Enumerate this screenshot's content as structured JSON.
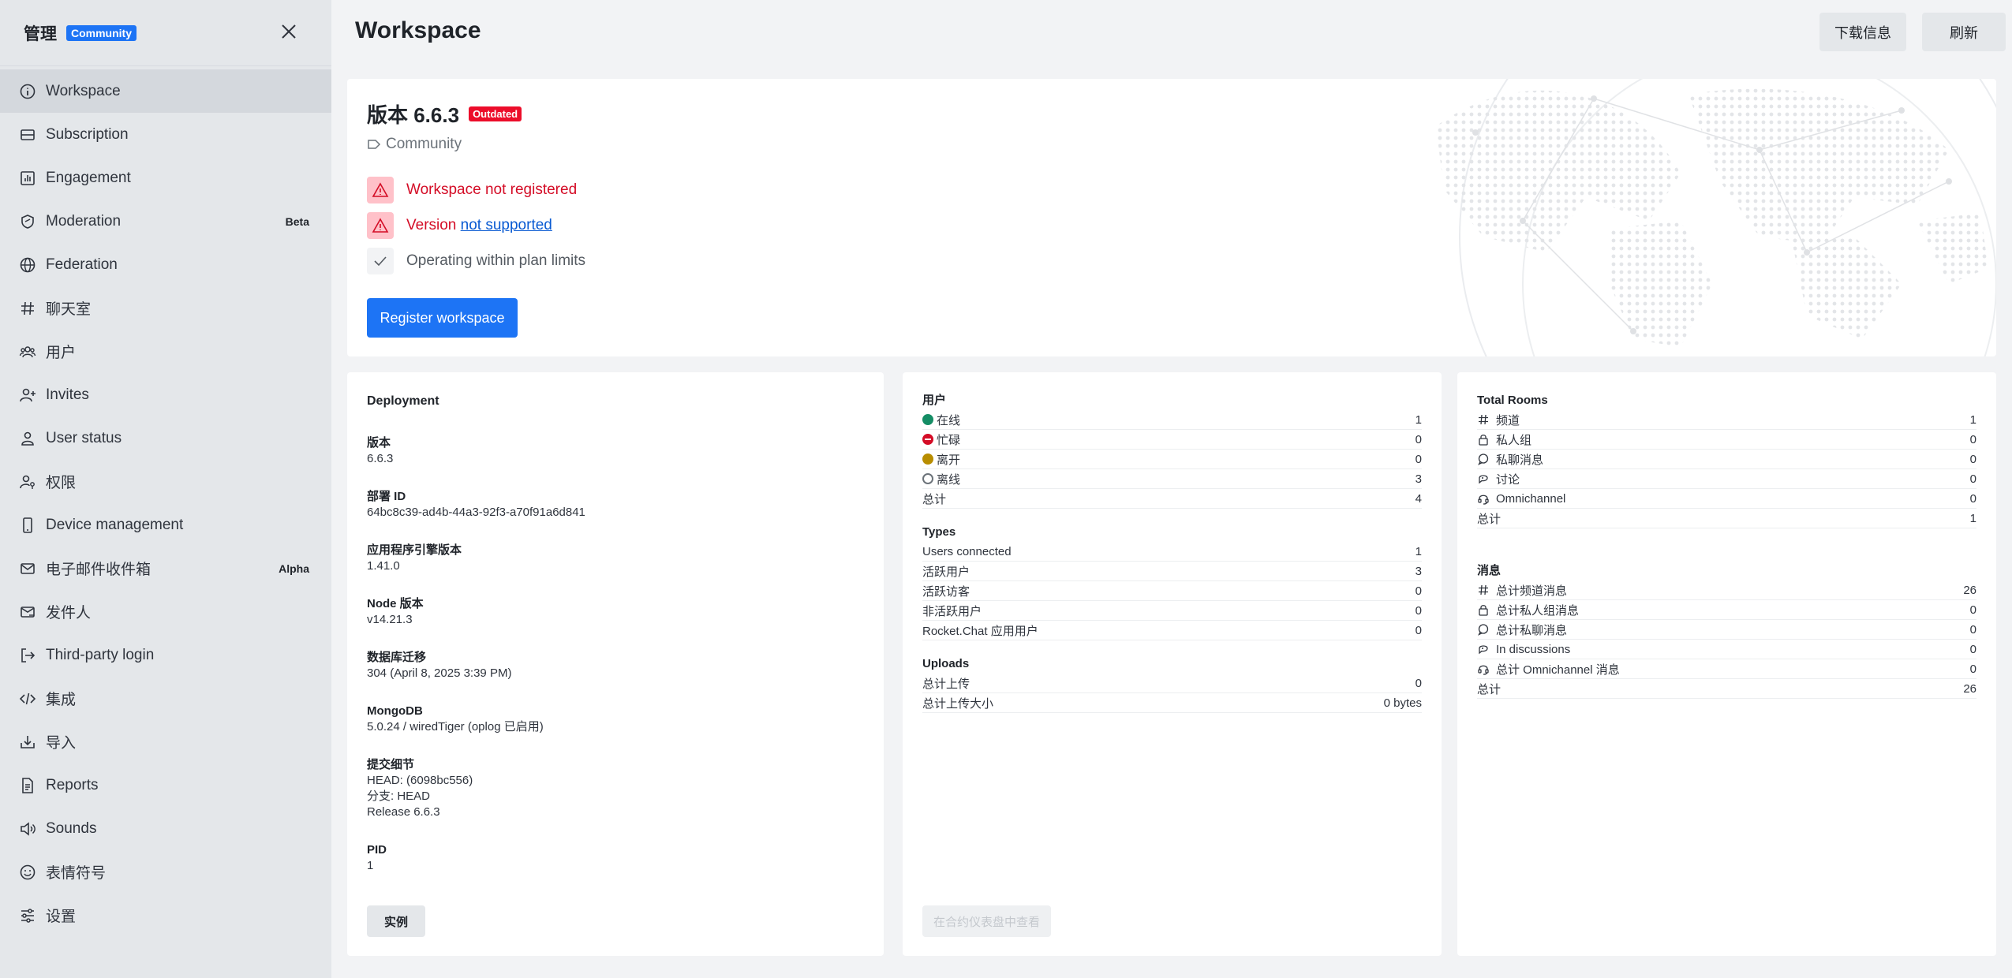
{
  "sidebar": {
    "title": "管理",
    "badge": "Community",
    "items": [
      {
        "label": "Workspace",
        "icon": "info-icon",
        "active": true
      },
      {
        "label": "Subscription",
        "icon": "card-icon"
      },
      {
        "label": "Engagement",
        "icon": "bar-chart-icon"
      },
      {
        "label": "Moderation",
        "icon": "shield-icon",
        "tag": "Beta"
      },
      {
        "label": "Federation",
        "icon": "globe-icon"
      },
      {
        "label": "聊天室",
        "icon": "hash-icon"
      },
      {
        "label": "用户",
        "icon": "team-icon"
      },
      {
        "label": "Invites",
        "icon": "user-plus-icon"
      },
      {
        "label": "User status",
        "icon": "user-icon"
      },
      {
        "label": "权限",
        "icon": "user-key-icon"
      },
      {
        "label": "Device management",
        "icon": "mobile-icon"
      },
      {
        "label": "电子邮件收件箱",
        "icon": "mail-icon",
        "tag": "Alpha"
      },
      {
        "label": "发件人",
        "icon": "mail-send-icon"
      },
      {
        "label": "Third-party login",
        "icon": "login-icon"
      },
      {
        "label": "集成",
        "icon": "code-icon"
      },
      {
        "label": "导入",
        "icon": "download-icon"
      },
      {
        "label": "Reports",
        "icon": "document-icon"
      },
      {
        "label": "Sounds",
        "icon": "speaker-icon"
      },
      {
        "label": "表情符号",
        "icon": "emoji-icon"
      },
      {
        "label": "设置",
        "icon": "sliders-icon"
      }
    ]
  },
  "header": {
    "title": "Workspace",
    "download_label": "下载信息",
    "refresh_label": "刷新"
  },
  "version_card": {
    "title": "版本 6.6.3",
    "outdated": "Outdated",
    "edition": "Community",
    "status_not_registered": "Workspace not registered",
    "status_version_prefix": "Version",
    "status_version_link": "not supported",
    "status_plan": "Operating within plan limits",
    "register_label": "Register workspace"
  },
  "deployment": {
    "heading": "Deployment",
    "fields": [
      {
        "label": "版本",
        "values": [
          "6.6.3"
        ]
      },
      {
        "label": "部署 ID",
        "values": [
          "64bc8c39-ad4b-44a3-92f3-a70f91a6d841"
        ]
      },
      {
        "label": "应用程序引擎版本",
        "values": [
          "1.41.0"
        ]
      },
      {
        "label": "Node 版本",
        "values": [
          "v14.21.3"
        ]
      },
      {
        "label": "数据库迁移",
        "values": [
          "304 (April 8, 2025 3:39 PM)"
        ]
      },
      {
        "label": "MongoDB",
        "values": [
          "5.0.24 / wiredTiger (oplog 已启用)"
        ]
      },
      {
        "label": "提交细节",
        "values": [
          "HEAD: (6098bc556)",
          "分支: HEAD",
          "Release 6.6.3"
        ]
      },
      {
        "label": "PID",
        "values": [
          "1"
        ]
      }
    ],
    "instances_label": "实例"
  },
  "users_panel": {
    "users": {
      "heading": "用户",
      "rows": [
        {
          "label": "在线",
          "status": "online",
          "value": "1"
        },
        {
          "label": "忙碌",
          "status": "busy",
          "value": "0"
        },
        {
          "label": "离开",
          "status": "away",
          "value": "0"
        },
        {
          "label": "离线",
          "status": "offline",
          "value": "3"
        },
        {
          "label": "总计",
          "value": "4"
        }
      ]
    },
    "types": {
      "heading": "Types",
      "rows": [
        {
          "label": "Users connected",
          "value": "1"
        },
        {
          "label": "活跃用户",
          "value": "3"
        },
        {
          "label": "活跃访客",
          "value": "0"
        },
        {
          "label": "非活跃用户",
          "value": "0"
        },
        {
          "label": "Rocket.Chat 应用用户",
          "value": "0"
        }
      ]
    },
    "uploads": {
      "heading": "Uploads",
      "rows": [
        {
          "label": "总计上传",
          "value": "0"
        },
        {
          "label": "总计上传大小",
          "value": "0 bytes"
        }
      ]
    },
    "engagement_button": "在合约仪表盘中查看"
  },
  "rooms_panel": {
    "rooms": {
      "heading": "Total Rooms",
      "rows": [
        {
          "label": "频道",
          "icon": "hash",
          "value": "1"
        },
        {
          "label": "私人组",
          "icon": "lock",
          "value": "0"
        },
        {
          "label": "私聊消息",
          "icon": "bubble",
          "value": "0"
        },
        {
          "label": "讨论",
          "icon": "discussion",
          "value": "0"
        },
        {
          "label": "Omnichannel",
          "icon": "headset",
          "value": "0"
        },
        {
          "label": "总计",
          "value": "1"
        }
      ]
    },
    "messages": {
      "heading": "消息",
      "rows": [
        {
          "label": "总计频道消息",
          "icon": "hash",
          "value": "26"
        },
        {
          "label": "总计私人组消息",
          "icon": "lock",
          "value": "0"
        },
        {
          "label": "总计私聊消息",
          "icon": "bubble",
          "value": "0"
        },
        {
          "label": "In discussions",
          "icon": "discussion",
          "value": "0"
        },
        {
          "label": "总计 Omnichannel 消息",
          "icon": "headset",
          "value": "0"
        },
        {
          "label": "总计",
          "value": "26"
        }
      ]
    }
  },
  "colors": {
    "primary": "#1d74f5",
    "danger": "#ec0d2a",
    "online": "#158d65",
    "busy": "#d40c26",
    "away": "#b88d00"
  }
}
